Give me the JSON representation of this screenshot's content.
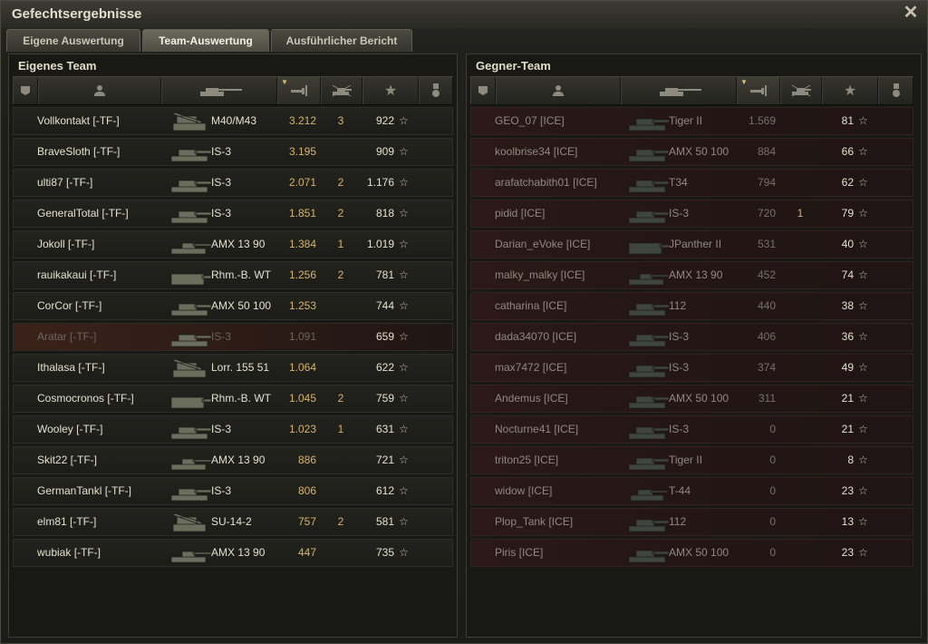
{
  "window": {
    "title": "Gefechtsergebnisse"
  },
  "tabs": [
    {
      "label": "Eigene Auswertung",
      "active": false
    },
    {
      "label": "Team-Auswertung",
      "active": true
    },
    {
      "label": "Ausführlicher Bericht",
      "active": false
    }
  ],
  "own_team": {
    "title": "Eigenes Team",
    "players": [
      {
        "name": "Vollkontakt [-TF-]",
        "tank": "M40/M43",
        "tank_class": "spg",
        "xp": "3.212",
        "kills": "3",
        "score": "922",
        "alive": true
      },
      {
        "name": "BraveSloth [-TF-]",
        "tank": "IS-3",
        "tank_class": "heavy",
        "xp": "3.195",
        "kills": "",
        "score": "909",
        "alive": true
      },
      {
        "name": "ulti87 [-TF-]",
        "tank": "IS-3",
        "tank_class": "heavy",
        "xp": "2.071",
        "kills": "2",
        "score": "1.176",
        "alive": true
      },
      {
        "name": "GeneralTotal [-TF-]",
        "tank": "IS-3",
        "tank_class": "heavy",
        "xp": "1.851",
        "kills": "2",
        "score": "818",
        "alive": true
      },
      {
        "name": "Jokoll [-TF-]",
        "tank": "AMX 13 90",
        "tank_class": "light",
        "xp": "1.384",
        "kills": "1",
        "score": "1.019",
        "alive": true
      },
      {
        "name": "rauikakaui [-TF-]",
        "tank": "Rhm.-B. WT",
        "tank_class": "td",
        "xp": "1.256",
        "kills": "2",
        "score": "781",
        "alive": true
      },
      {
        "name": "CorCor [-TF-]",
        "tank": "AMX 50 100",
        "tank_class": "heavy",
        "xp": "1.253",
        "kills": "",
        "score": "744",
        "alive": true
      },
      {
        "name": "Aratar [-TF-]",
        "tank": "IS-3",
        "tank_class": "heavy",
        "xp": "1.091",
        "kills": "",
        "score": "659",
        "alive": false
      },
      {
        "name": "Ithalasa [-TF-]",
        "tank": "Lorr. 155 51",
        "tank_class": "spg",
        "xp": "1.064",
        "kills": "",
        "score": "622",
        "alive": true
      },
      {
        "name": "Cosmocronos [-TF-]",
        "tank": "Rhm.-B. WT",
        "tank_class": "td",
        "xp": "1.045",
        "kills": "2",
        "score": "759",
        "alive": true
      },
      {
        "name": "Wooley [-TF-]",
        "tank": "IS-3",
        "tank_class": "heavy",
        "xp": "1.023",
        "kills": "1",
        "score": "631",
        "alive": true
      },
      {
        "name": "Skit22 [-TF-]",
        "tank": "AMX 13 90",
        "tank_class": "light",
        "xp": "886",
        "kills": "",
        "score": "721",
        "alive": true
      },
      {
        "name": "GermanTankl [-TF-]",
        "tank": "IS-3",
        "tank_class": "heavy",
        "xp": "806",
        "kills": "",
        "score": "612",
        "alive": true
      },
      {
        "name": "elm81 [-TF-]",
        "tank": "SU-14-2",
        "tank_class": "spg",
        "xp": "757",
        "kills": "2",
        "score": "581",
        "alive": true
      },
      {
        "name": "wubiak [-TF-]",
        "tank": "AMX 13 90",
        "tank_class": "light",
        "xp": "447",
        "kills": "",
        "score": "735",
        "alive": true
      }
    ]
  },
  "enemy_team": {
    "title": "Gegner-Team",
    "players": [
      {
        "name": "GEO_07 [ICE]",
        "tank": "Tiger II",
        "tank_class": "heavy",
        "xp": "1.569",
        "kills": "",
        "score": "81"
      },
      {
        "name": "koolbrise34 [ICE]",
        "tank": "AMX 50 100",
        "tank_class": "heavy",
        "xp": "884",
        "kills": "",
        "score": "66"
      },
      {
        "name": "arafatchabith01 [ICE]",
        "tank": "T34",
        "tank_class": "heavy",
        "xp": "794",
        "kills": "",
        "score": "62"
      },
      {
        "name": "pidid [ICE]",
        "tank": "IS-3",
        "tank_class": "heavy",
        "xp": "720",
        "kills": "1",
        "score": "79"
      },
      {
        "name": "Darian_eVoke [ICE]",
        "tank": "JPanther II",
        "tank_class": "td",
        "xp": "531",
        "kills": "",
        "score": "40"
      },
      {
        "name": "malky_malky [ICE]",
        "tank": "AMX 13 90",
        "tank_class": "light",
        "xp": "452",
        "kills": "",
        "score": "74"
      },
      {
        "name": "catharina [ICE]",
        "tank": "112",
        "tank_class": "heavy",
        "xp": "440",
        "kills": "",
        "score": "38"
      },
      {
        "name": "dada34070 [ICE]",
        "tank": "IS-3",
        "tank_class": "heavy",
        "xp": "406",
        "kills": "",
        "score": "36"
      },
      {
        "name": "max7472 [ICE]",
        "tank": "IS-3",
        "tank_class": "heavy",
        "xp": "374",
        "kills": "",
        "score": "49"
      },
      {
        "name": "Andemus [ICE]",
        "tank": "AMX 50 100",
        "tank_class": "heavy",
        "xp": "311",
        "kills": "",
        "score": "21"
      },
      {
        "name": "Nocturne41 [ICE]",
        "tank": "IS-3",
        "tank_class": "heavy",
        "xp": "0",
        "kills": "",
        "score": "21"
      },
      {
        "name": "triton25 [ICE]",
        "tank": "Tiger II",
        "tank_class": "heavy",
        "xp": "0",
        "kills": "",
        "score": "8"
      },
      {
        "name": "widow [ICE]",
        "tank": "T-44",
        "tank_class": "medium",
        "xp": "0",
        "kills": "",
        "score": "23"
      },
      {
        "name": "Plop_Tank [ICE]",
        "tank": "112",
        "tank_class": "heavy",
        "xp": "0",
        "kills": "",
        "score": "13"
      },
      {
        "name": "Piris [ICE]",
        "tank": "AMX 50 100",
        "tank_class": "heavy",
        "xp": "0",
        "kills": "",
        "score": "23"
      }
    ]
  },
  "columns": {
    "icons": [
      "squad-icon",
      "player-icon",
      "tank-icon",
      "damage-icon",
      "kills-icon",
      "star-icon",
      "medal-icon"
    ],
    "sorted_column": "damage-icon"
  },
  "colors": {
    "xp": "#d6b46a",
    "enemy_row": "#2a1917",
    "own_row": "#23231e",
    "destroyed_row": "#3b2219"
  }
}
